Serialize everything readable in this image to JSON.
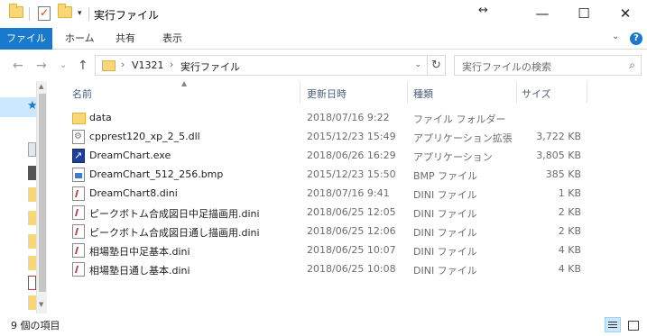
{
  "window": {
    "title": "実行ファイル",
    "controls": {
      "minimize": "—",
      "maximize": "☐",
      "close": "✕"
    },
    "resize_icon": "↔"
  },
  "quick_access": {
    "icons": [
      "folder-icon",
      "properties-icon",
      "new-folder-icon"
    ],
    "dropdown": "▾"
  },
  "ribbon": {
    "tabs": [
      "ファイル",
      "ホーム",
      "共有",
      "表示"
    ],
    "expand_icon": "⌄",
    "help_icon": "?"
  },
  "navigation": {
    "back": "←",
    "forward": "→",
    "recent": "⌄",
    "up": "↑"
  },
  "address": {
    "chevron": "›",
    "segments": [
      "V1321",
      "実行ファイル"
    ],
    "refresh": "↻"
  },
  "search": {
    "placeholder": "実行ファイルの検索",
    "icon": "⌕"
  },
  "columns": {
    "name": "名前",
    "date": "更新日時",
    "type": "種類",
    "size": "サイズ"
  },
  "files": [
    {
      "name": "data",
      "date": "2018/07/16 9:22",
      "type": "ファイル フォルダー",
      "size": "",
      "icon": "folder-icon"
    },
    {
      "name": "cpprest120_xp_2_5.dll",
      "date": "2015/12/23 15:49",
      "type": "アプリケーション拡張",
      "size": "3,722 KB",
      "icon": "dll-icon"
    },
    {
      "name": "DreamChart.exe",
      "date": "2018/06/26 16:29",
      "type": "アプリケーション",
      "size": "3,805 KB",
      "icon": "exe-icon"
    },
    {
      "name": "DreamChart_512_256.bmp",
      "date": "2015/12/23 15:50",
      "type": "BMP ファイル",
      "size": "385 KB",
      "icon": "bmp-icon"
    },
    {
      "name": "DreamChart8.dini",
      "date": "2018/07/16 9:41",
      "type": "DINI ファイル",
      "size": "1 KB",
      "icon": "dini-icon"
    },
    {
      "name": "ピークボトム合成図日中足描画用.dini",
      "date": "2018/06/25 12:05",
      "type": "DINI ファイル",
      "size": "2 KB",
      "icon": "dini-icon"
    },
    {
      "name": "ピークボトム合成図日通し描画用.dini",
      "date": "2018/06/25 12:06",
      "type": "DINI ファイル",
      "size": "2 KB",
      "icon": "dini-icon"
    },
    {
      "name": "相場塾日中足基本.dini",
      "date": "2018/06/25 10:07",
      "type": "DINI ファイル",
      "size": "4 KB",
      "icon": "dini-icon"
    },
    {
      "name": "相場塾日通し基本.dini",
      "date": "2018/06/25 10:08",
      "type": "DINI ファイル",
      "size": "4 KB",
      "icon": "dini-icon"
    }
  ],
  "status": {
    "item_count": "9 個の項目"
  },
  "colors": {
    "accent": "#1979ca",
    "selection": "#cce8ff",
    "folder": "#f8d775"
  }
}
